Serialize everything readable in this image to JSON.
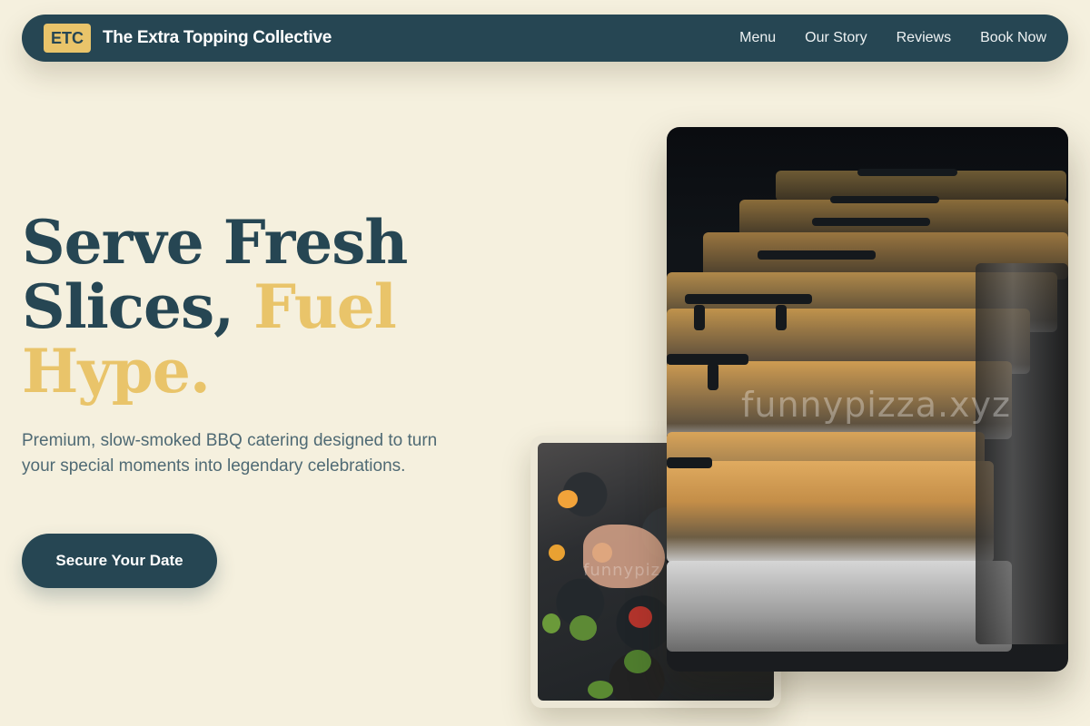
{
  "nav": {
    "logo_badge": "ETC",
    "brand_name": "The Extra Topping Collective",
    "links": [
      "Menu",
      "Our Story",
      "Reviews",
      "Book Now"
    ]
  },
  "hero": {
    "title_line1": "Serve Fresh",
    "title_line2_a": "Slices, ",
    "title_line2_b": "Fuel",
    "title_line3": "Hype.",
    "subtitle": "Premium, slow-smoked BBQ catering designed to turn your special moments into legendary celebrations.",
    "cta_label": "Secure Your Date"
  },
  "images": {
    "large_watermark": "funnypizza.xyz",
    "small_watermark": "funnypiz"
  },
  "colors": {
    "background": "#f5f0de",
    "primary": "#264653",
    "accent": "#e9c46a"
  }
}
